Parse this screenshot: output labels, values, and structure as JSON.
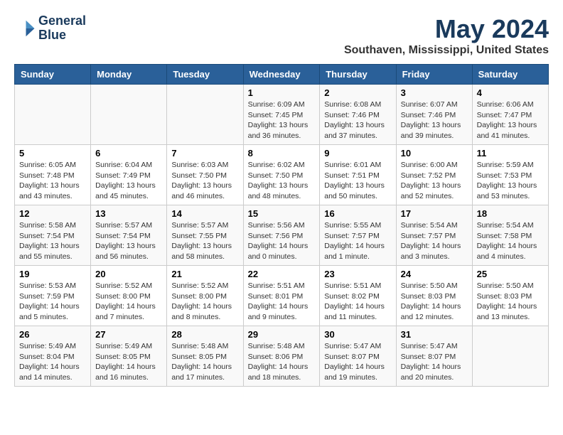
{
  "header": {
    "logo_line1": "General",
    "logo_line2": "Blue",
    "month_title": "May 2024",
    "location": "Southaven, Mississippi, United States"
  },
  "weekdays": [
    "Sunday",
    "Monday",
    "Tuesday",
    "Wednesday",
    "Thursday",
    "Friday",
    "Saturday"
  ],
  "weeks": [
    [
      {
        "day": "",
        "info": ""
      },
      {
        "day": "",
        "info": ""
      },
      {
        "day": "",
        "info": ""
      },
      {
        "day": "1",
        "info": "Sunrise: 6:09 AM\nSunset: 7:45 PM\nDaylight: 13 hours\nand 36 minutes."
      },
      {
        "day": "2",
        "info": "Sunrise: 6:08 AM\nSunset: 7:46 PM\nDaylight: 13 hours\nand 37 minutes."
      },
      {
        "day": "3",
        "info": "Sunrise: 6:07 AM\nSunset: 7:46 PM\nDaylight: 13 hours\nand 39 minutes."
      },
      {
        "day": "4",
        "info": "Sunrise: 6:06 AM\nSunset: 7:47 PM\nDaylight: 13 hours\nand 41 minutes."
      }
    ],
    [
      {
        "day": "5",
        "info": "Sunrise: 6:05 AM\nSunset: 7:48 PM\nDaylight: 13 hours\nand 43 minutes."
      },
      {
        "day": "6",
        "info": "Sunrise: 6:04 AM\nSunset: 7:49 PM\nDaylight: 13 hours\nand 45 minutes."
      },
      {
        "day": "7",
        "info": "Sunrise: 6:03 AM\nSunset: 7:50 PM\nDaylight: 13 hours\nand 46 minutes."
      },
      {
        "day": "8",
        "info": "Sunrise: 6:02 AM\nSunset: 7:50 PM\nDaylight: 13 hours\nand 48 minutes."
      },
      {
        "day": "9",
        "info": "Sunrise: 6:01 AM\nSunset: 7:51 PM\nDaylight: 13 hours\nand 50 minutes."
      },
      {
        "day": "10",
        "info": "Sunrise: 6:00 AM\nSunset: 7:52 PM\nDaylight: 13 hours\nand 52 minutes."
      },
      {
        "day": "11",
        "info": "Sunrise: 5:59 AM\nSunset: 7:53 PM\nDaylight: 13 hours\nand 53 minutes."
      }
    ],
    [
      {
        "day": "12",
        "info": "Sunrise: 5:58 AM\nSunset: 7:54 PM\nDaylight: 13 hours\nand 55 minutes."
      },
      {
        "day": "13",
        "info": "Sunrise: 5:57 AM\nSunset: 7:54 PM\nDaylight: 13 hours\nand 56 minutes."
      },
      {
        "day": "14",
        "info": "Sunrise: 5:57 AM\nSunset: 7:55 PM\nDaylight: 13 hours\nand 58 minutes."
      },
      {
        "day": "15",
        "info": "Sunrise: 5:56 AM\nSunset: 7:56 PM\nDaylight: 14 hours\nand 0 minutes."
      },
      {
        "day": "16",
        "info": "Sunrise: 5:55 AM\nSunset: 7:57 PM\nDaylight: 14 hours\nand 1 minute."
      },
      {
        "day": "17",
        "info": "Sunrise: 5:54 AM\nSunset: 7:57 PM\nDaylight: 14 hours\nand 3 minutes."
      },
      {
        "day": "18",
        "info": "Sunrise: 5:54 AM\nSunset: 7:58 PM\nDaylight: 14 hours\nand 4 minutes."
      }
    ],
    [
      {
        "day": "19",
        "info": "Sunrise: 5:53 AM\nSunset: 7:59 PM\nDaylight: 14 hours\nand 5 minutes."
      },
      {
        "day": "20",
        "info": "Sunrise: 5:52 AM\nSunset: 8:00 PM\nDaylight: 14 hours\nand 7 minutes."
      },
      {
        "day": "21",
        "info": "Sunrise: 5:52 AM\nSunset: 8:00 PM\nDaylight: 14 hours\nand 8 minutes."
      },
      {
        "day": "22",
        "info": "Sunrise: 5:51 AM\nSunset: 8:01 PM\nDaylight: 14 hours\nand 9 minutes."
      },
      {
        "day": "23",
        "info": "Sunrise: 5:51 AM\nSunset: 8:02 PM\nDaylight: 14 hours\nand 11 minutes."
      },
      {
        "day": "24",
        "info": "Sunrise: 5:50 AM\nSunset: 8:03 PM\nDaylight: 14 hours\nand 12 minutes."
      },
      {
        "day": "25",
        "info": "Sunrise: 5:50 AM\nSunset: 8:03 PM\nDaylight: 14 hours\nand 13 minutes."
      }
    ],
    [
      {
        "day": "26",
        "info": "Sunrise: 5:49 AM\nSunset: 8:04 PM\nDaylight: 14 hours\nand 14 minutes."
      },
      {
        "day": "27",
        "info": "Sunrise: 5:49 AM\nSunset: 8:05 PM\nDaylight: 14 hours\nand 16 minutes."
      },
      {
        "day": "28",
        "info": "Sunrise: 5:48 AM\nSunset: 8:05 PM\nDaylight: 14 hours\nand 17 minutes."
      },
      {
        "day": "29",
        "info": "Sunrise: 5:48 AM\nSunset: 8:06 PM\nDaylight: 14 hours\nand 18 minutes."
      },
      {
        "day": "30",
        "info": "Sunrise: 5:47 AM\nSunset: 8:07 PM\nDaylight: 14 hours\nand 19 minutes."
      },
      {
        "day": "31",
        "info": "Sunrise: 5:47 AM\nSunset: 8:07 PM\nDaylight: 14 hours\nand 20 minutes."
      },
      {
        "day": "",
        "info": ""
      }
    ]
  ]
}
